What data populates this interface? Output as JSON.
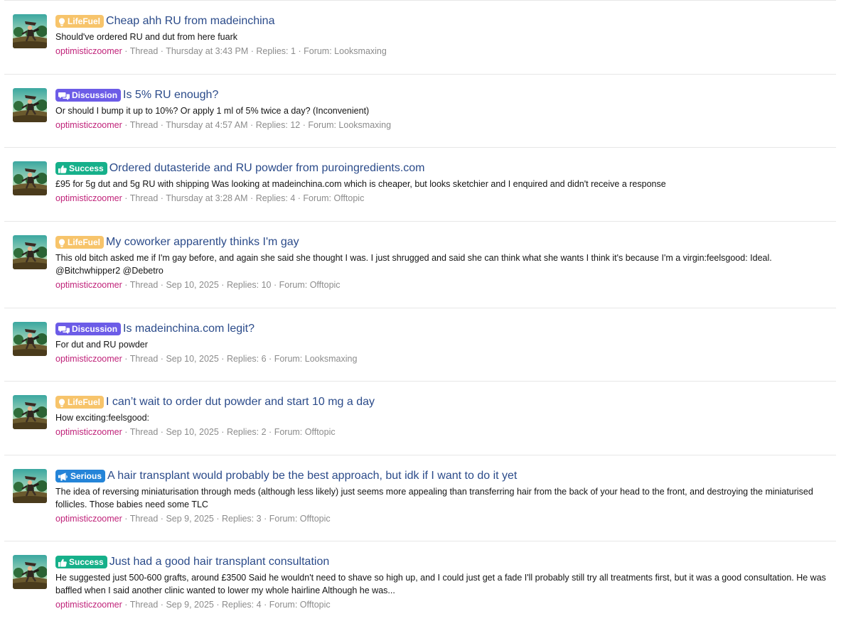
{
  "prefixes": {
    "lifefuel": {
      "label": "LifeFuel",
      "color": "#f7c46b",
      "icon": "lightbulb-icon"
    },
    "discussion": {
      "label": "Discussion",
      "color": "#6c5ce7",
      "icon": "chat-bubbles-icon"
    },
    "success": {
      "label": "Success",
      "color": "#16b08a",
      "icon": "thumbs-up-icon"
    },
    "serious": {
      "label": "Serious",
      "color": "#2484d8",
      "icon": "megaphone-icon"
    }
  },
  "results": [
    {
      "prefix": "lifefuel",
      "prefix_label": "LifeFuel",
      "title": "Cheap ahh RU from madeinchina",
      "snippet": "Should've ordered RU and dut from here fuark",
      "author": "optimisticzoomer",
      "type": "Thread",
      "date": "Thursday at 3:43 PM",
      "replies": "Replies: 1",
      "forum": "Forum: Looksmaxing"
    },
    {
      "prefix": "discussion",
      "prefix_label": "Discussion",
      "title": "Is 5% RU enough?",
      "snippet": "Or should I bump it up to 10%? Or apply 1 ml of 5% twice a day? (Inconvenient)",
      "author": "optimisticzoomer",
      "type": "Thread",
      "date": "Thursday at 4:57 AM",
      "replies": "Replies: 12",
      "forum": "Forum: Looksmaxing"
    },
    {
      "prefix": "success",
      "prefix_label": "Success",
      "title": "Ordered dutasteride and RU powder from puroingredients.com",
      "snippet": "£95 for 5g dut and 5g RU with shipping Was looking at madeinchina.com which is cheaper, but looks sketchier and I enquired and didn't receive a response",
      "author": "optimisticzoomer",
      "type": "Thread",
      "date": "Thursday at 3:28 AM",
      "replies": "Replies: 4",
      "forum": "Forum: Offtopic"
    },
    {
      "prefix": "lifefuel",
      "prefix_label": "LifeFuel",
      "title": "My coworker apparently thinks I'm gay",
      "snippet": "This old bitch asked me if I'm gay before, and again she said she thought I was. I just shrugged and said she can think what she wants I think it's because I'm a virgin:feelsgood: Ideal. @Bitchwhipper2 @Debetro",
      "author": "optimisticzoomer",
      "type": "Thread",
      "date": "Sep 10, 2025",
      "replies": "Replies: 10",
      "forum": "Forum: Offtopic"
    },
    {
      "prefix": "discussion",
      "prefix_label": "Discussion",
      "title": "Is madeinchina.com legit?",
      "snippet": "For dut and RU powder",
      "author": "optimisticzoomer",
      "type": "Thread",
      "date": "Sep 10, 2025",
      "replies": "Replies: 6",
      "forum": "Forum: Looksmaxing"
    },
    {
      "prefix": "lifefuel",
      "prefix_label": "LifeFuel",
      "title": "I can’t wait to order dut powder and start 10 mg a day",
      "snippet": "How exciting:feelsgood:",
      "author": "optimisticzoomer",
      "type": "Thread",
      "date": "Sep 10, 2025",
      "replies": "Replies: 2",
      "forum": "Forum: Offtopic"
    },
    {
      "prefix": "serious",
      "prefix_label": "Serious",
      "title": "A hair transplant would probably be the best approach, but idk if I want to do it yet",
      "snippet": "The idea of reversing miniaturisation through meds (although less likely) just seems more appealing than transferring hair from the back of your head to the front, and destroying the miniaturised follicles. Those babies need some TLC",
      "author": "optimisticzoomer",
      "type": "Thread",
      "date": "Sep 9, 2025",
      "replies": "Replies: 3",
      "forum": "Forum: Offtopic"
    },
    {
      "prefix": "success",
      "prefix_label": "Success",
      "title": "Just had a good hair transplant consultation",
      "snippet": "He suggested just 500-600 grafts, around £3500 Said he wouldn't need to shave so high up, and I could just get a fade I'll probably still try all treatments first, but it was a good consultation. He was baffled when I said another clinic wanted to lower my whole hairline Although he was...",
      "author": "optimisticzoomer",
      "type": "Thread",
      "date": "Sep 9, 2025",
      "replies": "Replies: 4",
      "forum": "Forum: Offtopic"
    }
  ],
  "separator": "·"
}
